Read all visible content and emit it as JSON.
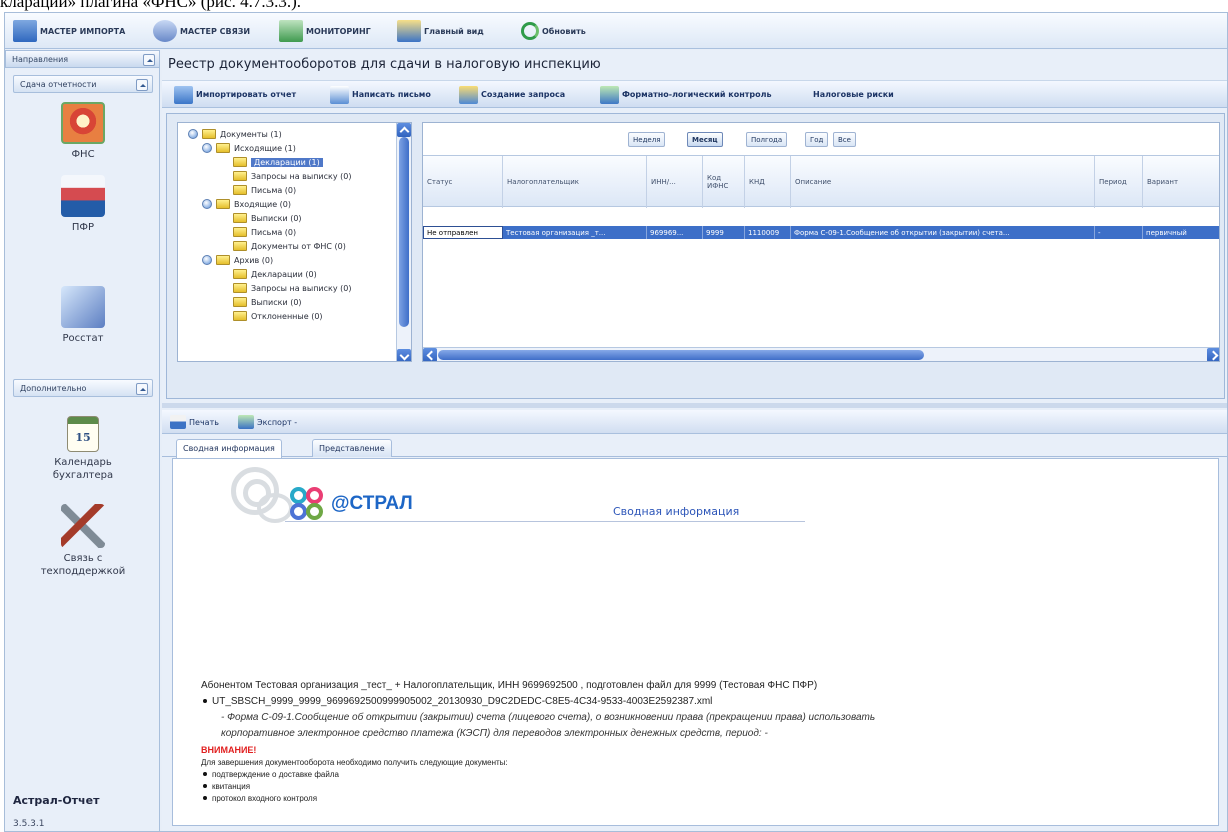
{
  "top_caption": "кларации» плагина «ФНС» (рис. 4.7.3.3.).",
  "toolbar": {
    "import_wizard": "МАСТЕР ИМПОРТА",
    "link_wizard": "МАСТЕР СВЯЗИ",
    "monitoring": "МОНИТОРИНГ",
    "main_view": "Главный вид",
    "refresh": "Обновить"
  },
  "left_panel": {
    "header": "Направления",
    "reporting_header": "Сдача отчетности",
    "items": [
      {
        "label": "ФНС",
        "icon": "fns-icon"
      },
      {
        "label": "ПФР",
        "icon": "pfr-icon"
      },
      {
        "label": "Росстат",
        "icon": "rosstat-icon"
      }
    ],
    "additional_header": "Дополнительно",
    "calendar_number": "15",
    "calendar_label_line1": "Календарь",
    "calendar_label_line2": "бухгалтера",
    "support_label_line1": "Связь с",
    "support_label_line2": "техподдержкой",
    "brand": "Астрал-Отчет",
    "version": "3.5.3.1"
  },
  "content": {
    "title": "Реестр документооборотов для сдачи в налоговую инспекцию",
    "actions": {
      "import_report": "Импортировать отчет",
      "write_letter": "Написать письмо",
      "create_request": "Создание запроса",
      "format_logic_check": "Форматно-логический контроль",
      "tax_risks": "Налоговые риски"
    }
  },
  "tree": {
    "documents": "Документы (1)",
    "outgoing": "Исходящие (1)",
    "outgoing_declarations": "Декларации (1)",
    "outgoing_requests": "Запросы на выписку (0)",
    "outgoing_letters": "Письма (0)",
    "incoming": "Входящие (0)",
    "incoming_statements": "Выписки (0)",
    "incoming_letters": "Письма (0)",
    "incoming_fns_docs": "Документы от ФНС (0)",
    "archive": "Архив (0)",
    "archive_declarations": "Декларации (0)",
    "archive_requests": "Запросы на выписку (0)",
    "archive_statements": "Выписки (0)",
    "archive_partial": "Отклоненные (0)"
  },
  "filters": [
    "Неделя",
    "Месяц",
    "Полгода",
    "Год",
    "Все"
  ],
  "grid": {
    "columns": [
      "Статус",
      "Налогоплательщик",
      "ИНН/...",
      "Код ИФНС",
      "КНД",
      "Описание",
      "Период",
      "Вариант"
    ],
    "row": [
      "Не отправлен",
      "Тестовая организация _т...",
      "969969...",
      "9999",
      "1110009",
      "Форма С-09-1.Сообщение об открытии (закрытии) счета...",
      "-",
      "первичный"
    ]
  },
  "lower_toolbar": {
    "print": "Печать",
    "export": "Экспорт -"
  },
  "tabs": [
    "Сводная информация",
    "Представление"
  ],
  "report": {
    "logo_text": "@СТРАЛ",
    "heading": "Сводная информация",
    "subscriber_line": "Абонентом Тестовая организация _тест_ + Налогоплательщик, ИНН 9699692500 , подготовлен файл для 9999 (Тестовая ФНС ПФР)",
    "file_line": "UT_SBSCH_9999_9999_9699692500999905002_20130930_D9C2DEDC-C8E5-4C34-9533-4003E2592387.xml",
    "form_line1": "- Форма  С-09-1.Сообщение об открытии (закрытии) счета (лицевого счета), о возникновении права (прекращении права) использовать",
    "form_line2": "корпоративное электронное средство платежа (КЭСП) для переводов электронных денежных средств, период:  -",
    "warning": "ВНИМАНИЕ!",
    "instruction": "Для завершения документооборота необходимо получить следующие документы:",
    "required_docs": [
      "подтверждение о доставке файла",
      "квитанция",
      "протокол входного контроля"
    ]
  },
  "colors": {
    "selection": "#3d6fc8",
    "accent": "#1d66c6",
    "warning": "#e11f1f"
  }
}
